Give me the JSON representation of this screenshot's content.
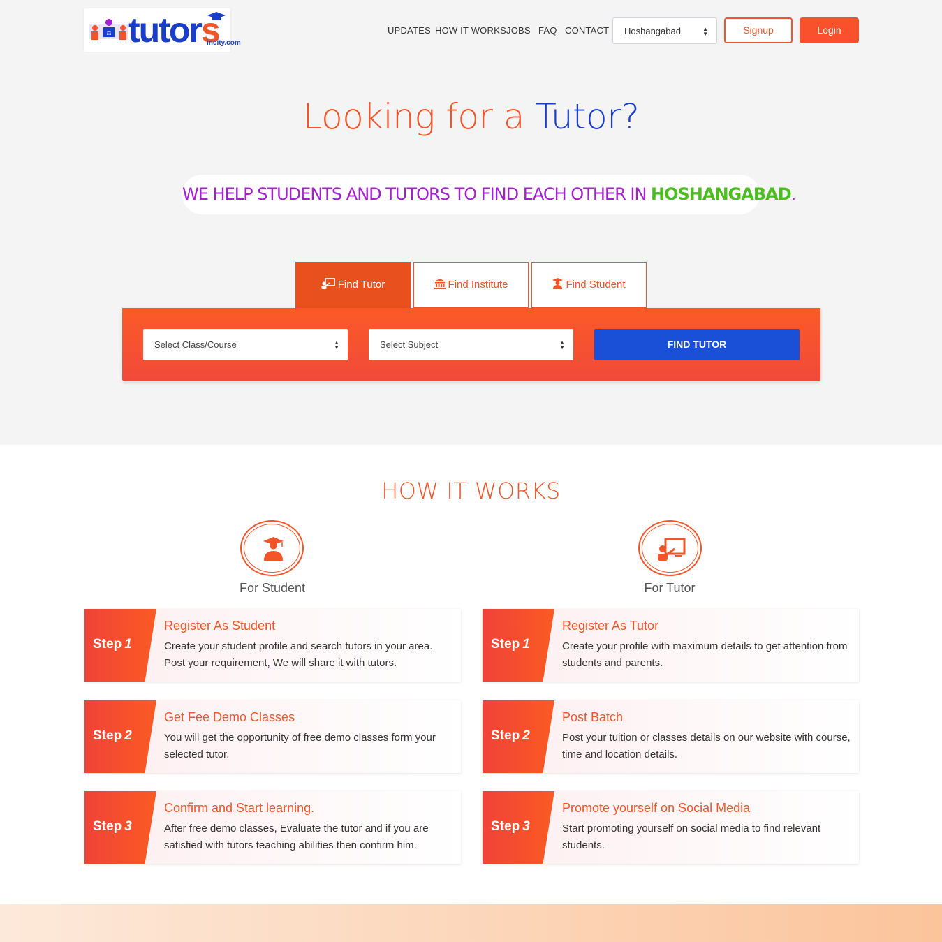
{
  "brand": {
    "name_main": "tutor",
    "name_s": "s",
    "domain": "incity.com"
  },
  "nav": {
    "items": [
      "UPDATES",
      "HOW IT WORKS",
      "JOBS",
      "FAQ",
      "CONTACT"
    ],
    "city": "Hoshangabad",
    "signup": "Signup",
    "login": "Login"
  },
  "hero": {
    "title_part1": "Looking for a ",
    "title_part2": "Tutor?",
    "tagline_part1": "WE HELP STUDENTS AND TUTORS TO FIND EACH OTHER IN ",
    "tagline_city": "HOSHANGABAD",
    "tagline_end": "."
  },
  "tabs": [
    {
      "label": "Find Tutor",
      "icon": "chalkboard-teacher-icon",
      "active": true
    },
    {
      "label": "Find Institute",
      "icon": "institution-icon",
      "active": false
    },
    {
      "label": "Find Student",
      "icon": "student-icon",
      "active": false
    }
  ],
  "search": {
    "class_placeholder": "Select Class/Course",
    "subject_placeholder": "Select Subject",
    "button": "FIND TUTOR"
  },
  "how_it_works": {
    "title": "HOW IT WORKS",
    "student": {
      "label": "For Student",
      "icon": "student-icon",
      "steps": [
        {
          "step": "Step",
          "num": "1",
          "title": "Register As Student",
          "desc": "Create your student profile and search tutors in your area. Post your requirement, We will share it with tutors."
        },
        {
          "step": "Step",
          "num": "2",
          "title": "Get Fee Demo Classes",
          "desc": "You will get the opportunity of free demo classes form your selected tutor."
        },
        {
          "step": "Step",
          "num": "3",
          "title": "Confirm and Start learning.",
          "desc": "After free demo classes, Evaluate the tutor and if you are satisfied with tutors teaching abilities then confirm him."
        }
      ]
    },
    "tutor": {
      "label": "For Tutor",
      "icon": "chalkboard-teacher-icon",
      "steps": [
        {
          "step": "Step",
          "num": "1",
          "title": "Register As Tutor",
          "desc": "Create your profile with maximum details to get attention from students and parents."
        },
        {
          "step": "Step",
          "num": "2",
          "title": "Post Batch",
          "desc": "Post your tuition or classes details on our website with course, time and location details."
        },
        {
          "step": "Step",
          "num": "3",
          "title": "Promote yourself on Social Media",
          "desc": "Start promoting yourself on social media to find relevant students."
        }
      ]
    }
  },
  "colors": {
    "accent": "#f2552a",
    "brand_blue": "#1a3ec8",
    "tagline": "#a31fcf",
    "city": "#4cbd1f",
    "button_blue": "#1a4fd8"
  }
}
